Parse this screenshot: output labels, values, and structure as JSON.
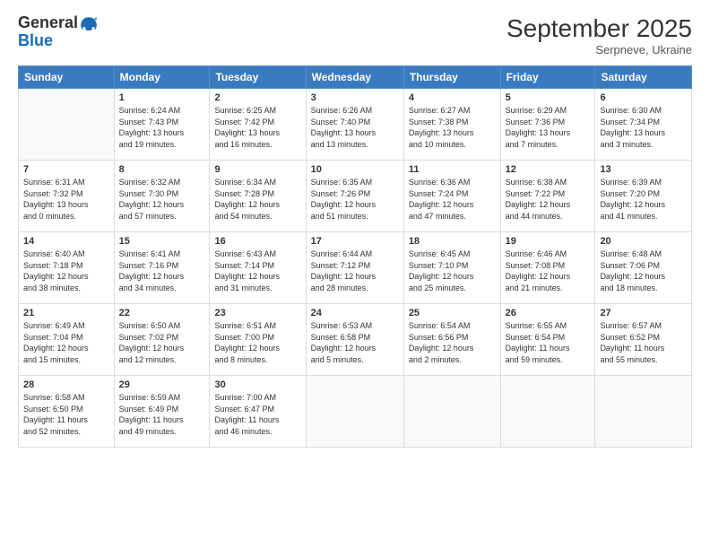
{
  "logo": {
    "general": "General",
    "blue": "Blue"
  },
  "header": {
    "month": "September 2025",
    "location": "Serpneve, Ukraine"
  },
  "days_of_week": [
    "Sunday",
    "Monday",
    "Tuesday",
    "Wednesday",
    "Thursday",
    "Friday",
    "Saturday"
  ],
  "weeks": [
    [
      {
        "day": "",
        "info": ""
      },
      {
        "day": "1",
        "info": "Sunrise: 6:24 AM\nSunset: 7:43 PM\nDaylight: 13 hours\nand 19 minutes."
      },
      {
        "day": "2",
        "info": "Sunrise: 6:25 AM\nSunset: 7:42 PM\nDaylight: 13 hours\nand 16 minutes."
      },
      {
        "day": "3",
        "info": "Sunrise: 6:26 AM\nSunset: 7:40 PM\nDaylight: 13 hours\nand 13 minutes."
      },
      {
        "day": "4",
        "info": "Sunrise: 6:27 AM\nSunset: 7:38 PM\nDaylight: 13 hours\nand 10 minutes."
      },
      {
        "day": "5",
        "info": "Sunrise: 6:29 AM\nSunset: 7:36 PM\nDaylight: 13 hours\nand 7 minutes."
      },
      {
        "day": "6",
        "info": "Sunrise: 6:30 AM\nSunset: 7:34 PM\nDaylight: 13 hours\nand 3 minutes."
      }
    ],
    [
      {
        "day": "7",
        "info": "Sunrise: 6:31 AM\nSunset: 7:32 PM\nDaylight: 13 hours\nand 0 minutes."
      },
      {
        "day": "8",
        "info": "Sunrise: 6:32 AM\nSunset: 7:30 PM\nDaylight: 12 hours\nand 57 minutes."
      },
      {
        "day": "9",
        "info": "Sunrise: 6:34 AM\nSunset: 7:28 PM\nDaylight: 12 hours\nand 54 minutes."
      },
      {
        "day": "10",
        "info": "Sunrise: 6:35 AM\nSunset: 7:26 PM\nDaylight: 12 hours\nand 51 minutes."
      },
      {
        "day": "11",
        "info": "Sunrise: 6:36 AM\nSunset: 7:24 PM\nDaylight: 12 hours\nand 47 minutes."
      },
      {
        "day": "12",
        "info": "Sunrise: 6:38 AM\nSunset: 7:22 PM\nDaylight: 12 hours\nand 44 minutes."
      },
      {
        "day": "13",
        "info": "Sunrise: 6:39 AM\nSunset: 7:20 PM\nDaylight: 12 hours\nand 41 minutes."
      }
    ],
    [
      {
        "day": "14",
        "info": "Sunrise: 6:40 AM\nSunset: 7:18 PM\nDaylight: 12 hours\nand 38 minutes."
      },
      {
        "day": "15",
        "info": "Sunrise: 6:41 AM\nSunset: 7:16 PM\nDaylight: 12 hours\nand 34 minutes."
      },
      {
        "day": "16",
        "info": "Sunrise: 6:43 AM\nSunset: 7:14 PM\nDaylight: 12 hours\nand 31 minutes."
      },
      {
        "day": "17",
        "info": "Sunrise: 6:44 AM\nSunset: 7:12 PM\nDaylight: 12 hours\nand 28 minutes."
      },
      {
        "day": "18",
        "info": "Sunrise: 6:45 AM\nSunset: 7:10 PM\nDaylight: 12 hours\nand 25 minutes."
      },
      {
        "day": "19",
        "info": "Sunrise: 6:46 AM\nSunset: 7:08 PM\nDaylight: 12 hours\nand 21 minutes."
      },
      {
        "day": "20",
        "info": "Sunrise: 6:48 AM\nSunset: 7:06 PM\nDaylight: 12 hours\nand 18 minutes."
      }
    ],
    [
      {
        "day": "21",
        "info": "Sunrise: 6:49 AM\nSunset: 7:04 PM\nDaylight: 12 hours\nand 15 minutes."
      },
      {
        "day": "22",
        "info": "Sunrise: 6:50 AM\nSunset: 7:02 PM\nDaylight: 12 hours\nand 12 minutes."
      },
      {
        "day": "23",
        "info": "Sunrise: 6:51 AM\nSunset: 7:00 PM\nDaylight: 12 hours\nand 8 minutes."
      },
      {
        "day": "24",
        "info": "Sunrise: 6:53 AM\nSunset: 6:58 PM\nDaylight: 12 hours\nand 5 minutes."
      },
      {
        "day": "25",
        "info": "Sunrise: 6:54 AM\nSunset: 6:56 PM\nDaylight: 12 hours\nand 2 minutes."
      },
      {
        "day": "26",
        "info": "Sunrise: 6:55 AM\nSunset: 6:54 PM\nDaylight: 11 hours\nand 59 minutes."
      },
      {
        "day": "27",
        "info": "Sunrise: 6:57 AM\nSunset: 6:52 PM\nDaylight: 11 hours\nand 55 minutes."
      }
    ],
    [
      {
        "day": "28",
        "info": "Sunrise: 6:58 AM\nSunset: 6:50 PM\nDaylight: 11 hours\nand 52 minutes."
      },
      {
        "day": "29",
        "info": "Sunrise: 6:59 AM\nSunset: 6:49 PM\nDaylight: 11 hours\nand 49 minutes."
      },
      {
        "day": "30",
        "info": "Sunrise: 7:00 AM\nSunset: 6:47 PM\nDaylight: 11 hours\nand 46 minutes."
      },
      {
        "day": "",
        "info": ""
      },
      {
        "day": "",
        "info": ""
      },
      {
        "day": "",
        "info": ""
      },
      {
        "day": "",
        "info": ""
      }
    ]
  ]
}
